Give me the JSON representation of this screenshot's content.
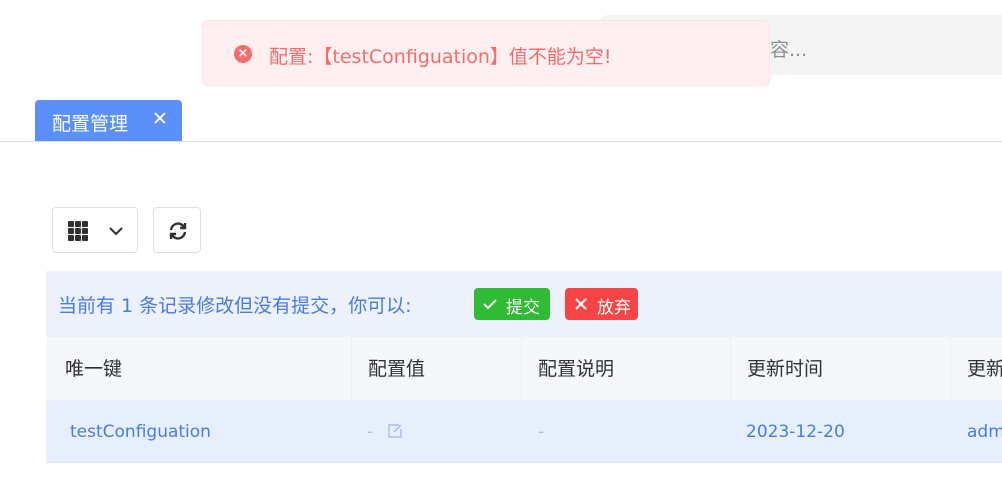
{
  "search": {
    "placeholder": "容..."
  },
  "toast": {
    "type": "error",
    "message": "配置:【testConfiguation】值不能为空!"
  },
  "tabs": [
    {
      "label": "配置管理",
      "active": true
    }
  ],
  "toolbar": {
    "columns_icon": "grid-icon",
    "refresh_icon": "refresh-icon"
  },
  "info_bar": {
    "message": "当前有 1 条记录修改但没有提交，你可以:",
    "submit_label": "提交",
    "discard_label": "放弃"
  },
  "table": {
    "columns": [
      "唯一键",
      "配置值",
      "配置说明",
      "更新时间",
      "更新"
    ],
    "rows": [
      {
        "key": "testConfiguation",
        "value": "-",
        "description": "-",
        "updated_at": "2023-12-20",
        "updated_by": "adm"
      }
    ]
  },
  "colors": {
    "accent": "#5b8ff9",
    "error": "#f56c6c",
    "success": "#2fbb33",
    "danger": "#f54545",
    "link": "#4a7be0"
  }
}
